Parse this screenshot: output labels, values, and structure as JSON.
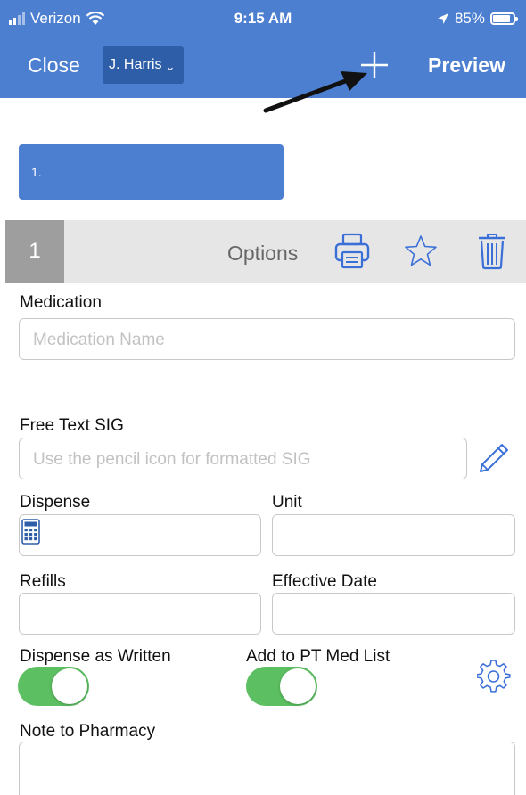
{
  "status_bar": {
    "carrier": "Verizon",
    "time": "9:15 AM",
    "battery": "85%",
    "battery_level": 0.85
  },
  "nav": {
    "close_label": "Close",
    "provider_label": "J. Harris",
    "preview_label": "Preview"
  },
  "prescription_tab": {
    "label": "1."
  },
  "options_bar": {
    "number": "1",
    "options_label": "Options"
  },
  "form": {
    "medication": {
      "label": "Medication",
      "placeholder": "Medication Name",
      "value": ""
    },
    "sig": {
      "label": "Free Text SIG",
      "placeholder": "Use the pencil icon for formatted SIG",
      "value": ""
    },
    "dispense": {
      "label": "Dispense",
      "value": ""
    },
    "unit": {
      "label": "Unit",
      "value": ""
    },
    "refills": {
      "label": "Refills",
      "value": ""
    },
    "effective_date": {
      "label": "Effective Date",
      "value": ""
    },
    "dispense_as_written": {
      "label": "Dispense as Written",
      "on": true
    },
    "add_to_med_list": {
      "label": "Add to PT Med List",
      "on": true
    },
    "note": {
      "label": "Note to Pharmacy",
      "value": ""
    }
  },
  "colors": {
    "header": "#4c7fd0",
    "provider_chip": "#2f5ea8",
    "toggle_on": "#5cbf61",
    "icon_blue": "#3a6fd8"
  },
  "icons": [
    "wifi-icon",
    "location-icon",
    "battery-icon",
    "plus-icon",
    "printer-icon",
    "star-icon",
    "trash-icon",
    "pencil-icon",
    "calculator-icon",
    "gear-icon",
    "arrow-annotation"
  ]
}
